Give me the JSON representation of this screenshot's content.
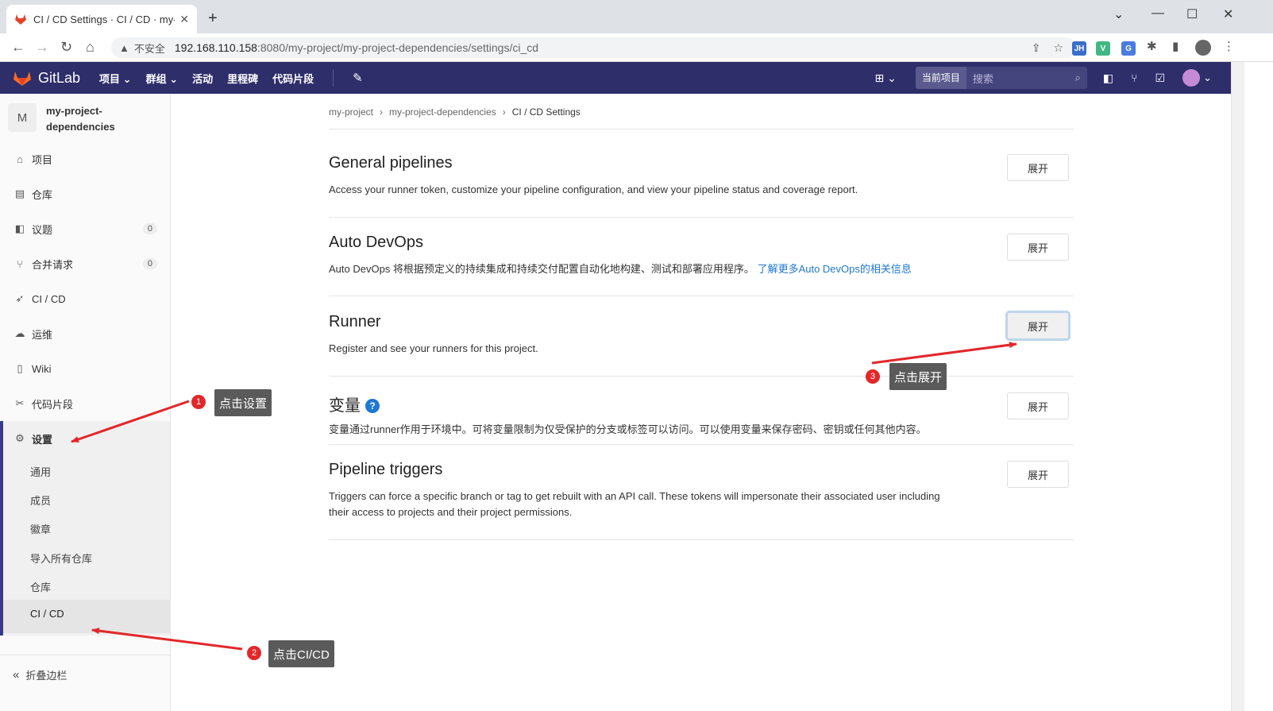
{
  "browser": {
    "tab_title": "CI / CD Settings · CI / CD · my-",
    "insecure_label": "不安全",
    "url_host": "192.168.110.158",
    "url_rest": ":8080/my-project/my-project-dependencies/settings/ci_cd",
    "extensions": [
      {
        "label": "JH",
        "color": "#3b6ec9"
      },
      {
        "label": "V",
        "color": "#41b883"
      },
      {
        "label": "G",
        "color": "#4a7be0"
      }
    ]
  },
  "header": {
    "brand": "GitLab",
    "nav": [
      "项目",
      "群组",
      "活动",
      "里程碑",
      "代码片段"
    ],
    "search_scope": "当前项目",
    "search_placeholder": "搜索",
    "brand_color": "#2e2e6b"
  },
  "sidebar": {
    "avatar_letter": "M",
    "project_name_line1": "my-project-",
    "project_name_line2": "dependencies",
    "items": [
      {
        "label": "项目",
        "icon": "home-icon"
      },
      {
        "label": "仓库",
        "icon": "doc-icon"
      },
      {
        "label": "议题",
        "icon": "issues-icon",
        "badge": "0"
      },
      {
        "label": "合并请求",
        "icon": "merge-icon",
        "badge": "0"
      },
      {
        "label": "CI / CD",
        "icon": "rocket-icon"
      },
      {
        "label": "运维",
        "icon": "cloud-icon"
      },
      {
        "label": "Wiki",
        "icon": "book-icon"
      },
      {
        "label": "代码片段",
        "icon": "scissors-icon"
      },
      {
        "label": "设置",
        "icon": "gear-icon"
      }
    ],
    "settings_sub": [
      "通用",
      "成员",
      "徽章",
      "导入所有仓库",
      "仓库",
      "CI / CD"
    ],
    "collapse_label": "折叠边栏"
  },
  "breadcrumb": [
    "my-project",
    "my-project-dependencies",
    "CI / CD Settings"
  ],
  "sections": [
    {
      "title": "General pipelines",
      "desc": "Access your runner token, customize your pipeline configuration, and view your pipeline status and coverage report.",
      "button": "展开"
    },
    {
      "title": "Auto DevOps",
      "desc": "Auto DevOps 将根据预定义的持续集成和持续交付配置自动化地构建、测试和部署应用程序。",
      "link": "了解更多Auto DevOps的相关信息",
      "button": "展开"
    },
    {
      "title": "Runner",
      "desc": "Register and see your runners for this project.",
      "button": "展开"
    },
    {
      "title": "变量",
      "desc": "变量通过runner作用于环境中。可将变量限制为仅受保护的分支或标签可以访问。可以使用变量来保存密码、密钥或任何其他内容。",
      "button": "展开"
    },
    {
      "title": "Pipeline triggers",
      "desc_line1": "Triggers can force a specific branch or tag to get rebuilt with an API call. These tokens will impersonate their associated user including",
      "desc_line2": "their access to projects and their project permissions.",
      "button": "展开"
    }
  ],
  "annotations": [
    {
      "num": "1",
      "label": "点击设置"
    },
    {
      "num": "2",
      "label": "点击CI/CD"
    },
    {
      "num": "3",
      "label": "点击展开"
    }
  ]
}
